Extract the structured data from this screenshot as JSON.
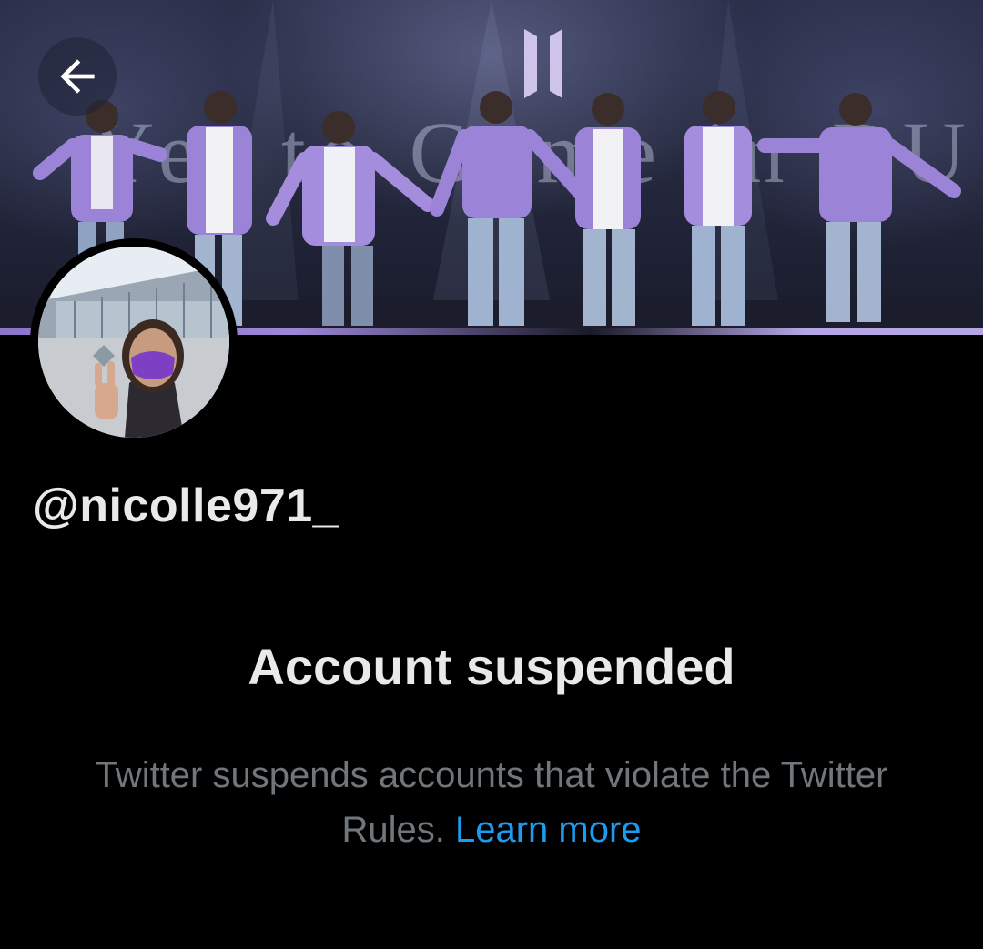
{
  "profile": {
    "handle": "@nicolle971_"
  },
  "icons": {
    "back": "arrow-left-icon"
  },
  "notice": {
    "title": "Account suspended",
    "description": "Twitter suspends accounts that violate the Twitter Rules.",
    "link_label": "Learn more"
  },
  "banner": {
    "logo_text": "Yet to Come in BUSAN"
  },
  "colors": {
    "background": "#000000",
    "primary_text": "#e7e9ea",
    "secondary_text": "#71767b",
    "link": "#1d9bf0",
    "accent_purple": "#9b84d8"
  }
}
